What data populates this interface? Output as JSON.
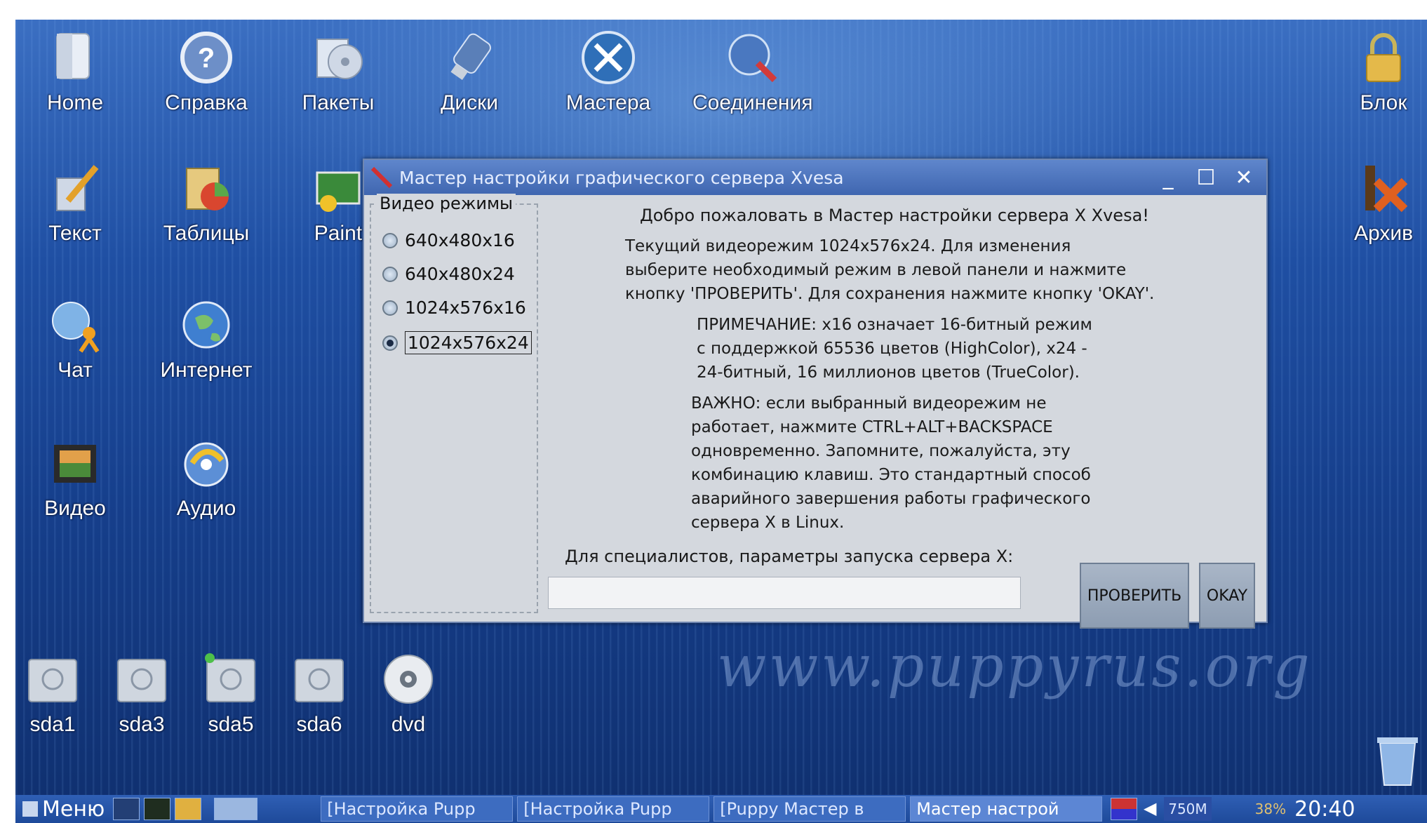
{
  "desktop": {
    "icons": [
      {
        "label": "Home",
        "icon": "home-folder-icon"
      },
      {
        "label": "Справка",
        "icon": "help-icon"
      },
      {
        "label": "Пакеты",
        "icon": "packages-icon"
      },
      {
        "label": "Диски",
        "icon": "usb-drive-icon"
      },
      {
        "label": "Мастера",
        "icon": "wizard-tools-icon"
      },
      {
        "label": "Соединения",
        "icon": "network-connect-icon"
      },
      {
        "label": "Блок",
        "icon": "lock-icon"
      },
      {
        "label": "Текст",
        "icon": "text-editor-icon"
      },
      {
        "label": "Таблицы",
        "icon": "spreadsheet-icon"
      },
      {
        "label": "Paint",
        "icon": "paint-icon"
      },
      {
        "label": "Архив",
        "icon": "archive-icon"
      },
      {
        "label": "Чат",
        "icon": "chat-icon"
      },
      {
        "label": "Интернет",
        "icon": "globe-icon"
      },
      {
        "label": "Видео",
        "icon": "video-icon"
      },
      {
        "label": "Аудио",
        "icon": "audio-icon"
      }
    ],
    "drives": [
      {
        "label": "sda1",
        "icon": "drive-icon"
      },
      {
        "label": "sda3",
        "icon": "drive-icon"
      },
      {
        "label": "sda5",
        "icon": "drive-icon"
      },
      {
        "label": "sda6",
        "icon": "drive-icon"
      },
      {
        "label": "dvd",
        "icon": "dvd-icon"
      }
    ],
    "watermark": "www.puppyrus.org"
  },
  "dialog": {
    "title": "Мастер настройки графического сервера Xvesa",
    "modes_legend": "Видео режимы",
    "modes": [
      "640x480x16",
      "640x480x24",
      "1024x576x16",
      "1024x576x24"
    ],
    "selected_mode": "1024x576x24",
    "welcome": "Добро пожаловать в Мастер настройки сервера X Xvesa!",
    "intro_lines": [
      "Текущий видеорежим 1024x576x24. Для изменения",
      "выберите необходимый режим в левой панели и нажмите",
      "кнопку 'ПРОВЕРИТЬ'. Для сохранения нажмите кнопку 'OKAY'."
    ],
    "note_lines": [
      "ПРИМЕЧАНИЕ: x16 означает 16-битный режим",
      "с поддержкой 65536 цветов (HighColor), x24 -",
      "24-битный, 16 миллионов цветов (TrueColor)."
    ],
    "important_lines": [
      "ВАЖНО: если выбранный видеорежим не",
      "работает, нажмите CTRL+ALT+BACKSPACE",
      "одновременно. Запомните, пожалуйста, эту",
      "комбинацию клавиш. Это стандартный способ",
      "аварийного завершения работы графического",
      "сервера X в Linux."
    ],
    "params_label": "Для специалистов, параметры запуска сервера X:",
    "params_value": "",
    "check_button": "ПРОВЕРИТЬ",
    "okay_button": "OKAY"
  },
  "taskbar": {
    "menu": "Меню",
    "tasks": [
      "[Настройка Pupp",
      "[Настройка Pupp",
      "[Puppy Мастер в",
      "Мастер настрой"
    ],
    "memory": "750M",
    "battery": "38%",
    "clock": "20:40"
  },
  "colors": {
    "desktop_top": "#3b6fc2",
    "desktop_bottom": "#0f2f6e",
    "titlebar": "#4a72bb",
    "dialog_bg": "#d4d8de",
    "taskbar": "#2a57aa"
  }
}
